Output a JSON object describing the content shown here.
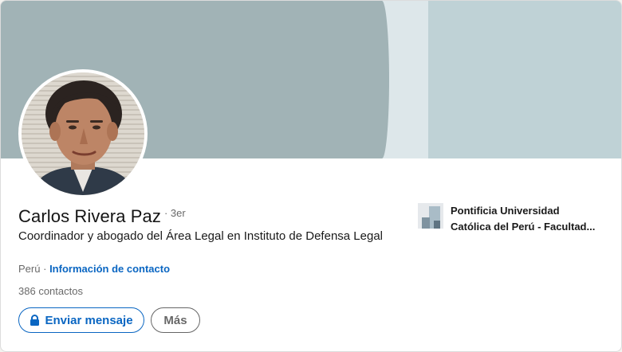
{
  "profile": {
    "name": "Carlos Rivera Paz",
    "degree": "· 3er",
    "headline": "Coordinador y abogado del Área Legal en Instituto de Defensa Legal",
    "location": "Perú",
    "separator": "·",
    "contact_info_label": "Información de contacto",
    "connections_count": "386",
    "connections_label": "contactos"
  },
  "actions": {
    "message_label": "Enviar mensaje",
    "more_label": "Más"
  },
  "education": {
    "school_line1": "Pontificia Universidad",
    "school_line2": "Católica del Perú - Facultad..."
  },
  "icons": {
    "message_button": "lock-icon",
    "school_logo": "school-logo"
  },
  "colors": {
    "link_blue": "#0a66c2",
    "banner_dark": "#a1b3b6",
    "banner_light": "#dde7ea",
    "banner_mid": "#bfd2d6"
  }
}
